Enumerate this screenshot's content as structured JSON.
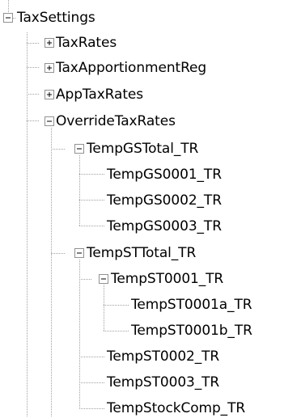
{
  "tree": {
    "root": {
      "label": "TaxSettings",
      "expanded": true
    },
    "nodes": [
      {
        "label": "TaxRates",
        "expanded": false
      },
      {
        "label": "TaxApportionmentReg",
        "expanded": false
      },
      {
        "label": "AppTaxRates",
        "expanded": false
      },
      {
        "label": "OverrideTaxRates",
        "expanded": true
      },
      {
        "label": "TempGSTotal_TR",
        "expanded": true
      },
      {
        "label": "TempGS0001_TR"
      },
      {
        "label": "TempGS0002_TR"
      },
      {
        "label": "TempGS0003_TR"
      },
      {
        "label": "TempSTTotal_TR",
        "expanded": true
      },
      {
        "label": "TempST0001_TR",
        "expanded": true
      },
      {
        "label": "TempST0001a_TR"
      },
      {
        "label": "TempST0001b_TR"
      },
      {
        "label": "TempST0002_TR"
      },
      {
        "label": "TempST0003_TR"
      },
      {
        "label": "TempStockComp_TR"
      }
    ]
  }
}
